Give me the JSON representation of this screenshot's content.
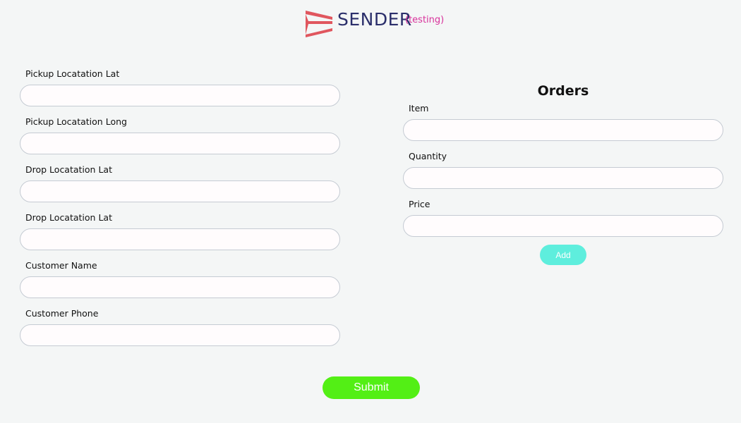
{
  "header": {
    "brand": "SENDER",
    "env_tag": "(testing)",
    "logo_icon": "sender-logo-icon",
    "colors": {
      "logo": "#e0565e",
      "brand": "#2b2f6b",
      "env_tag": "#d8319b"
    }
  },
  "pickup_drop_form": {
    "fields": [
      {
        "label": "Pickup Locatation Lat",
        "value": "",
        "placeholder": ""
      },
      {
        "label": "Pickup Locatation Long",
        "value": "",
        "placeholder": ""
      },
      {
        "label": "Drop Locatation Lat",
        "value": "",
        "placeholder": ""
      },
      {
        "label": "Drop Locatation Lat",
        "value": "",
        "placeholder": ""
      },
      {
        "label": "Customer Name",
        "value": "",
        "placeholder": ""
      },
      {
        "label": "Customer Phone",
        "value": "",
        "placeholder": ""
      }
    ]
  },
  "orders": {
    "title": "Orders",
    "fields": [
      {
        "label": "Item",
        "value": "",
        "placeholder": ""
      },
      {
        "label": "Quantity",
        "value": "",
        "placeholder": ""
      },
      {
        "label": "Price",
        "value": "",
        "placeholder": ""
      }
    ],
    "add_label": "Add",
    "add_color": "#5eeedd"
  },
  "submit": {
    "label": "Submit",
    "color": "#53ef15"
  }
}
